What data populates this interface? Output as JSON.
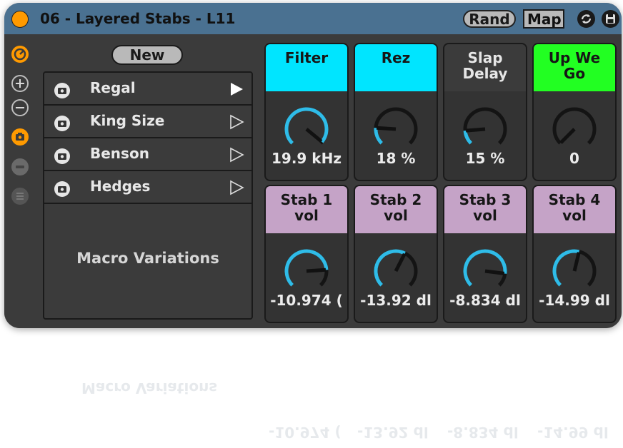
{
  "header": {
    "title": "06 - Layered Stabs - L11",
    "rand_label": "Rand",
    "map_label": "Map",
    "icons": [
      "fold-icon",
      "randomize-icon",
      "save-icon"
    ]
  },
  "sidebar": {
    "icons": [
      "hotswap-icon",
      "add-icon",
      "remove-icon",
      "snapshot-icon",
      "collapse-icon",
      "list-icon"
    ]
  },
  "variations": {
    "new_label": "New",
    "items": [
      {
        "label": "Regal"
      },
      {
        "label": "King Size"
      },
      {
        "label": "Benson"
      },
      {
        "label": "Hedges"
      }
    ],
    "footer_label": "Macro Variations"
  },
  "macros": [
    {
      "label": "Filter",
      "value": "19.9 kHz",
      "level": 0.98,
      "color": "#00e5ff"
    },
    {
      "label": "Rez",
      "value": "18 %",
      "level": 0.18,
      "color": "#00e5ff"
    },
    {
      "label": "Slap\nDelay",
      "value": "15 %",
      "level": 0.15,
      "color": "#3b3b3b"
    },
    {
      "label": "Up We\nGo",
      "value": "0",
      "level": 0.0,
      "color": "#22ff22"
    },
    {
      "label": "Stab 1\nvol",
      "value": "-10.974 (",
      "level": 0.82,
      "color": "#c5a3c7"
    },
    {
      "label": "Stab 2\nvol",
      "value": "-13.92 dl",
      "level": 0.6,
      "color": "#c5a3c7"
    },
    {
      "label": "Stab 3\nvol",
      "value": "-8.834 dl",
      "level": 0.86,
      "color": "#c5a3c7"
    },
    {
      "label": "Stab 4\nvol",
      "value": "-14.99 dl",
      "level": 0.55,
      "color": "#c5a3c7"
    }
  ],
  "colors": {
    "knob_arc": "#2fbce8",
    "titlebar": "#4a7191",
    "accent_orange": "#ff9a00"
  }
}
